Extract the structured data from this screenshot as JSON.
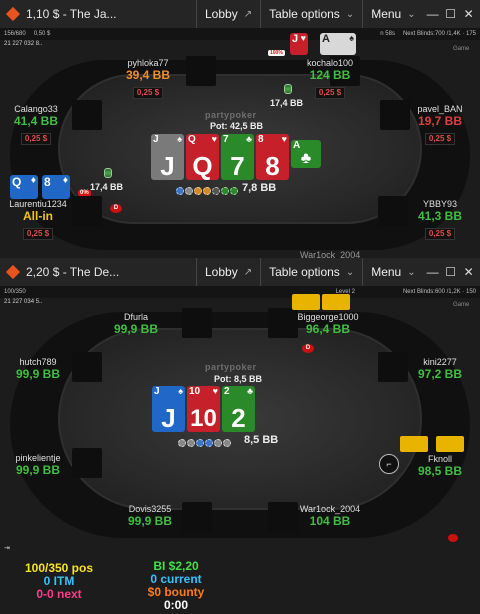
{
  "window1": {
    "title": "1,10 $ - The Ja...",
    "menu": {
      "lobby": "Lobby",
      "table_options": "Table options",
      "menu": "Menu"
    },
    "info": {
      "players": "156/680",
      "left_extra": "0,50 $",
      "right_blinds_prefix": "n 58s",
      "next_blinds": "Next Blinds:700 /1,4K · 175"
    },
    "id_line": "21 227 032 8..",
    "brand": "partypoker",
    "pot": "Pot: 42,5 BB",
    "pot_amount": "7,8 BB",
    "board": [
      {
        "rank": "J",
        "suit": "♠",
        "color": "grey"
      },
      {
        "rank": "Q",
        "suit": "♥",
        "color": "red"
      },
      {
        "rank": "7",
        "suit": "♣",
        "color": "green"
      },
      {
        "rank": "8",
        "suit": "♥",
        "color": "red"
      },
      {
        "rank": "A",
        "suit": "♣",
        "color": "green"
      }
    ],
    "players": {
      "pyhloka77": {
        "name": "pyhloka77",
        "stack": "39,4 BB",
        "bet": "0,25 $"
      },
      "kochalo100": {
        "name": "kochalo100",
        "stack": "124 BB",
        "bet": "0,25 $",
        "pct": "100%",
        "cards": [
          {
            "rank": "J",
            "suit": "♥"
          },
          {
            "rank": "A",
            "suit": "♠"
          }
        ]
      },
      "calango33": {
        "name": "Calango33",
        "stack": "41,4 BB",
        "bet": "0,25 $"
      },
      "pavel_ban": {
        "name": "pavel_BAN",
        "stack": "19,7 BB",
        "bet": "0,25 $"
      },
      "laurentiu": {
        "name": "Laurentiu1234",
        "status": "All-in",
        "bet": "0,25 $",
        "pct": "0%",
        "cards": [
          {
            "rank": "Q",
            "suit": "♦"
          },
          {
            "rank": "8",
            "suit": "♦"
          }
        ]
      },
      "ybby93": {
        "name": "YBBY93",
        "stack": "41,3 BB",
        "bet": "0,25 $"
      },
      "war1ock": {
        "name": "War1ock_2004"
      }
    },
    "side_bets": {
      "top": "17,4 BB",
      "left": "17,4 BB"
    },
    "game_label": "Game"
  },
  "window2": {
    "title": "2,20 $ - The De...",
    "menu": {
      "lobby": "Lobby",
      "table_options": "Table options",
      "menu": "Menu"
    },
    "info": {
      "players": "100/350",
      "level": "Level 2",
      "next_blinds": "Next Blinds:600 /1,2K · 150"
    },
    "id_line": "21 227 034 5..",
    "brand": "partypoker",
    "pot": "Pot: 8,5 BB",
    "pot_amount": "8,5 BB",
    "board": [
      {
        "rank": "J",
        "suit": "♠",
        "color": "blue"
      },
      {
        "rank": "10",
        "suit": "♥",
        "color": "red"
      },
      {
        "rank": "2",
        "suit": "♣",
        "color": "green"
      }
    ],
    "players": {
      "dfurla": {
        "name": "Dfurla",
        "stack": "99,9 BB"
      },
      "biggeorge": {
        "name": "Biggeorge1000",
        "stack": "96,4 BB"
      },
      "hutch789": {
        "name": "hutch789",
        "stack": "99,9 BB"
      },
      "kini2277": {
        "name": "kini2277",
        "stack": "97,2 BB"
      },
      "pinkelientje": {
        "name": "pinkelientje",
        "stack": "99,9 BB"
      },
      "fknoll": {
        "name": "Fknoll",
        "stack": "98,5 BB"
      },
      "dovis3255": {
        "name": "Dovis3255",
        "stack": "99,9 BB"
      },
      "war1ock": {
        "name": "War1ock_2004",
        "stack": "104 BB"
      }
    },
    "game_label": "Game",
    "hud": {
      "pos": "100/350 pos",
      "itm": "0 ITM",
      "next": "0-0 next",
      "bi": "BI $2,20",
      "current": "0 current",
      "bounty": "$0 bounty",
      "timer": "0:00"
    }
  }
}
